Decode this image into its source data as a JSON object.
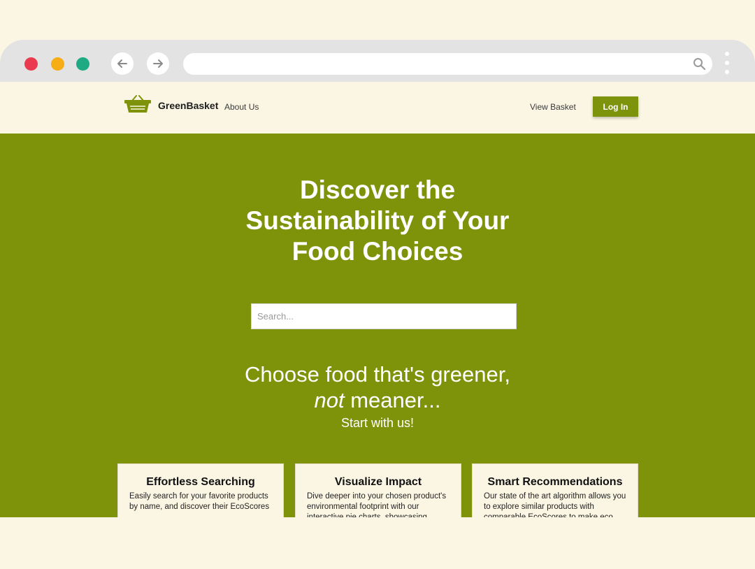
{
  "browser": {
    "url": "",
    "icons": [
      "arrow-left-icon",
      "arrow-right-icon",
      "search-icon",
      "kebab-menu-icon"
    ]
  },
  "header": {
    "brand": "GreenBasket",
    "about": "About Us",
    "view_basket": "View Basket",
    "login": "Log In"
  },
  "hero": {
    "title_lines": [
      "Discover the",
      "Sustainability of Your",
      "Food Choices"
    ],
    "search_placeholder": "Search...",
    "tagline_line1": "Choose food that's greener,",
    "tagline_em": "not",
    "tagline_line2_rest": " meaner...",
    "start": "Start with us!"
  },
  "features": [
    {
      "title": "Effortless Searching",
      "text": "Easily search for your favorite products by name, and discover their EcoScores"
    },
    {
      "title": "Visualize Impact",
      "text": "Dive deeper into your chosen product's environmental footprint with our interactive pie charts, showcasing carbon"
    },
    {
      "title": "Smart Recommendations",
      "text": "Our state of the art algorithm allows you to explore similar products with comparable EcoScores to make eco"
    }
  ],
  "colors": {
    "brand_green": "#7e930a",
    "cream": "#fbf6e3",
    "dot_red": "#ea3a4f",
    "dot_yellow": "#f7ad16",
    "dot_green": "#1faa83"
  }
}
